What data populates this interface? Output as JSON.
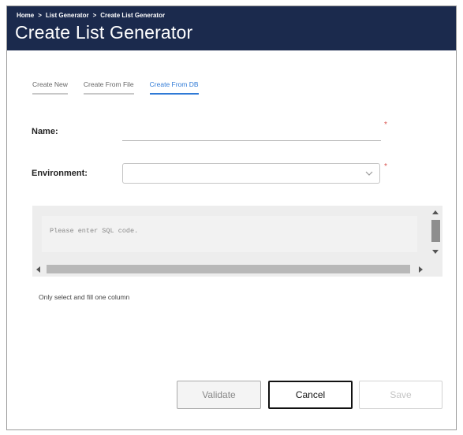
{
  "breadcrumb": {
    "items": [
      "Home",
      "List Generator",
      "Create List Generator"
    ],
    "separator": ">"
  },
  "page": {
    "title": "Create List Generator"
  },
  "tabs": [
    {
      "label": "Create New",
      "active": false
    },
    {
      "label": "Create From File",
      "active": false
    },
    {
      "label": "Create From DB",
      "active": true
    }
  ],
  "form": {
    "name_label": "Name:",
    "name_value": "",
    "environment_label": "Environment:",
    "environment_value": "",
    "required_marker": "*",
    "sql_placeholder": "Please enter SQL code.",
    "hint": "Only select and fill one column"
  },
  "buttons": {
    "validate": "Validate",
    "cancel": "Cancel",
    "save": "Save"
  },
  "colors": {
    "header_bg": "#1b2a4d",
    "active_tab": "#2f7ad6",
    "required": "#d9534f"
  },
  "icons": {
    "dropdown": "chevron-down-icon",
    "scroll_up": "arrow-up-icon",
    "scroll_down": "arrow-down-icon",
    "scroll_left": "arrow-left-icon",
    "scroll_right": "arrow-right-icon"
  }
}
